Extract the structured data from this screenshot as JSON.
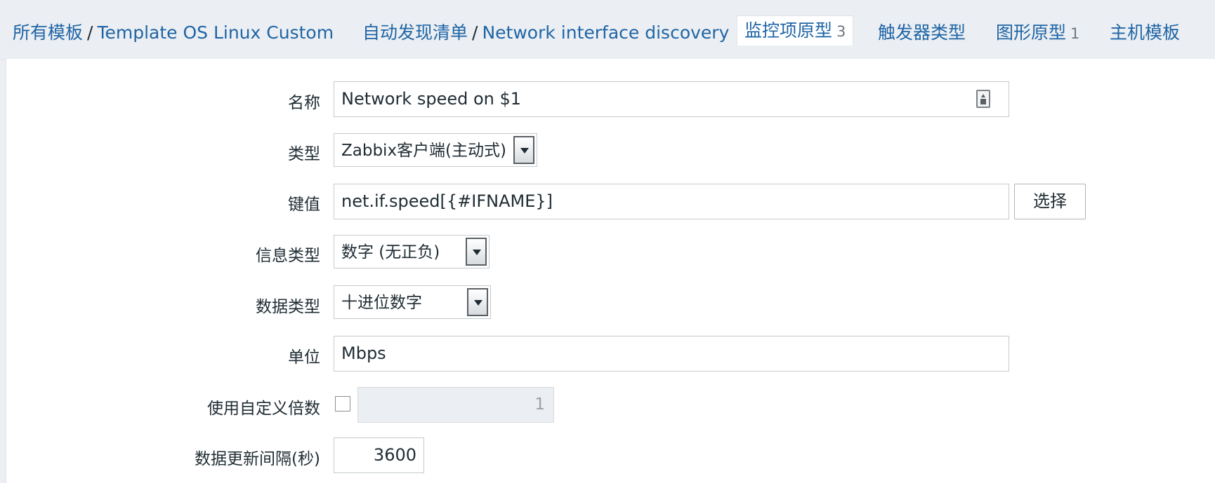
{
  "breadcrumb": {
    "all_templates": "所有模板",
    "separator": "/",
    "template_name": "Template OS Linux Custom",
    "discovery_list": "自动发现清单",
    "discovery_rule": "Network interface discovery"
  },
  "tabs": [
    {
      "label": "监控项原型",
      "count": "3",
      "active": true
    },
    {
      "label": "触发器类型",
      "count": ""
    },
    {
      "label": "图形原型",
      "count": "1"
    },
    {
      "label": "主机模板",
      "count": ""
    }
  ],
  "form": {
    "name": {
      "label": "名称",
      "value": "Network speed on $1"
    },
    "type": {
      "label": "类型",
      "value": "Zabbix客户端(主动式)"
    },
    "key": {
      "label": "键值",
      "value": "net.if.speed[{#IFNAME}]",
      "select_button": "选择"
    },
    "info_type": {
      "label": "信息类型",
      "value": "数字 (无正负)"
    },
    "data_type": {
      "label": "数据类型",
      "value": "十进位数字"
    },
    "units": {
      "label": "单位",
      "value": "Mbps"
    },
    "custom_multiplier": {
      "label": "使用自定义倍数",
      "checked": false,
      "value": "1"
    },
    "update_interval": {
      "label": "数据更新间隔(秒)",
      "value": "3600"
    }
  },
  "colors": {
    "link": "#1f65a6",
    "background": "#ebeef2",
    "panel": "#ffffff"
  }
}
